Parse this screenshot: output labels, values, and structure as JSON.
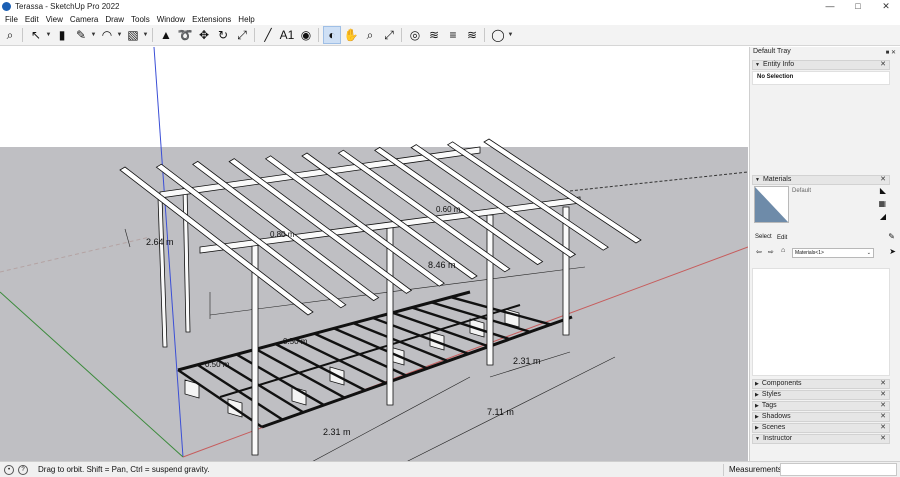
{
  "window": {
    "title": "Terassa - SketchUp Pro 2022",
    "controls": [
      "—",
      "□",
      "✕"
    ]
  },
  "menu": [
    "File",
    "Edit",
    "View",
    "Camera",
    "Draw",
    "Tools",
    "Window",
    "Extensions",
    "Help"
  ],
  "toolbar": [
    {
      "name": "search-icon",
      "glyph": "⌕"
    },
    {
      "name": "select-tool-icon",
      "glyph": "↖",
      "caret": true
    },
    {
      "name": "eraser-tool-icon",
      "glyph": "▮"
    },
    {
      "name": "pencil-line-tool-icon",
      "glyph": "✎",
      "caret": true
    },
    {
      "name": "arc-tool-icon",
      "glyph": "◠",
      "caret": true
    },
    {
      "name": "shape-tool-icon",
      "glyph": "▧",
      "caret": true
    },
    {
      "name": "push-pull-tool-icon",
      "glyph": "▲"
    },
    {
      "name": "follow-me-tool-icon",
      "glyph": "➰"
    },
    {
      "name": "move-tool-icon",
      "glyph": "✥"
    },
    {
      "name": "rotate-tool-icon",
      "glyph": "↻"
    },
    {
      "name": "scale-tool-icon",
      "glyph": "⤢"
    },
    {
      "name": "tape-measure-tool-icon",
      "glyph": "╱"
    },
    {
      "name": "text-tool-icon",
      "glyph": "A1"
    },
    {
      "name": "paint-bucket-tool-icon",
      "glyph": "◉"
    },
    {
      "name": "orbit-tool-icon",
      "glyph": "◐",
      "active": true
    },
    {
      "name": "pan-tool-icon",
      "glyph": "✋"
    },
    {
      "name": "zoom-tool-icon",
      "glyph": "⌕"
    },
    {
      "name": "zoom-extents-tool-icon",
      "glyph": "⤢"
    },
    {
      "name": "warehouse-icon",
      "glyph": "◎"
    },
    {
      "name": "extension-warehouse-icon",
      "glyph": "≋"
    },
    {
      "name": "layout-icon",
      "glyph": "≡"
    },
    {
      "name": "extension-manager-icon",
      "glyph": "≋"
    },
    {
      "name": "account-icon",
      "glyph": "◯",
      "caret": true
    }
  ],
  "tray": {
    "title": "Default Tray",
    "header_buttons": "■ ✕",
    "entity_info": {
      "title": "Entity Info",
      "text": "No Selection"
    },
    "materials": {
      "title": "Materials",
      "material_name": "Default",
      "tabs": [
        "Select",
        "Edit"
      ],
      "library": "Materials<1>",
      "swatch_color": "#6e8ba9"
    },
    "collapsed_panels": [
      "Components",
      "Styles",
      "Tags",
      "Shadows",
      "Scenes",
      "Instructor"
    ]
  },
  "viewport": {
    "sky_color": "#ffffff",
    "ground_color": "#bfbfc3",
    "dimensions": [
      "2.64 m",
      "8.46 m",
      "2.31 m",
      "7.11 m",
      "2.31 m",
      "0.50 m",
      "0.80 m",
      "0.60 m",
      "0.50 m"
    ]
  },
  "status": {
    "hint": "Drag to orbit. Shift = Pan, Ctrl = suspend gravity.",
    "measurements_label": "Measurements",
    "measurements_value": ""
  }
}
